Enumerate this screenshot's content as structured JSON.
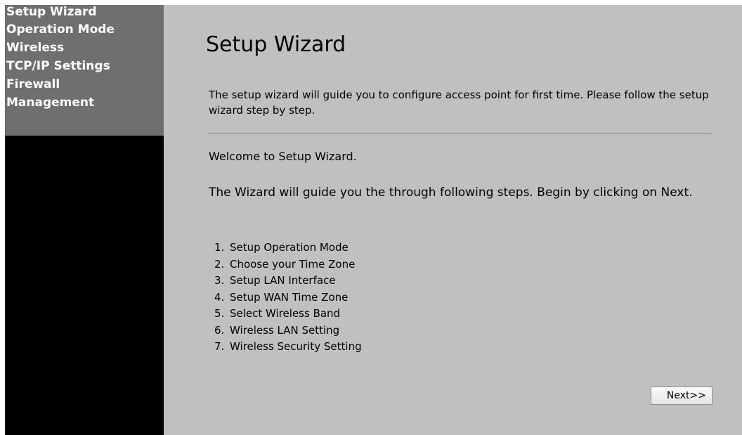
{
  "sidebar": {
    "items": [
      {
        "label": "Setup Wizard"
      },
      {
        "label": "Operation Mode"
      },
      {
        "label": "Wireless"
      },
      {
        "label": "TCP/IP Settings"
      },
      {
        "label": "Firewall"
      },
      {
        "label": "Management"
      }
    ]
  },
  "main": {
    "title": "Setup Wizard",
    "intro": "The setup wizard will guide you to configure access point for first time. Please follow the setup wizard step by step.",
    "welcome": "Welcome to Setup Wizard.",
    "guide": "The Wizard will guide you the through following steps. Begin by clicking on Next.",
    "steps": [
      {
        "num": "1.",
        "label": "Setup Operation Mode"
      },
      {
        "num": "2.",
        "label": "Choose your Time Zone"
      },
      {
        "num": "3.",
        "label": "Setup LAN Interface"
      },
      {
        "num": "4.",
        "label": "Setup WAN Time Zone"
      },
      {
        "num": "5.",
        "label": "Select Wireless Band"
      },
      {
        "num": "6.",
        "label": "Wireless LAN Setting"
      },
      {
        "num": "7.",
        "label": "Wireless Security Setting"
      }
    ],
    "next_label": "Next>>"
  },
  "colors": {
    "sidebar_menu_bg": "#6f6f6f",
    "sidebar_bg": "#000000",
    "main_bg": "#c0c0c0",
    "text": "#000000",
    "menu_text": "#ffffff"
  }
}
